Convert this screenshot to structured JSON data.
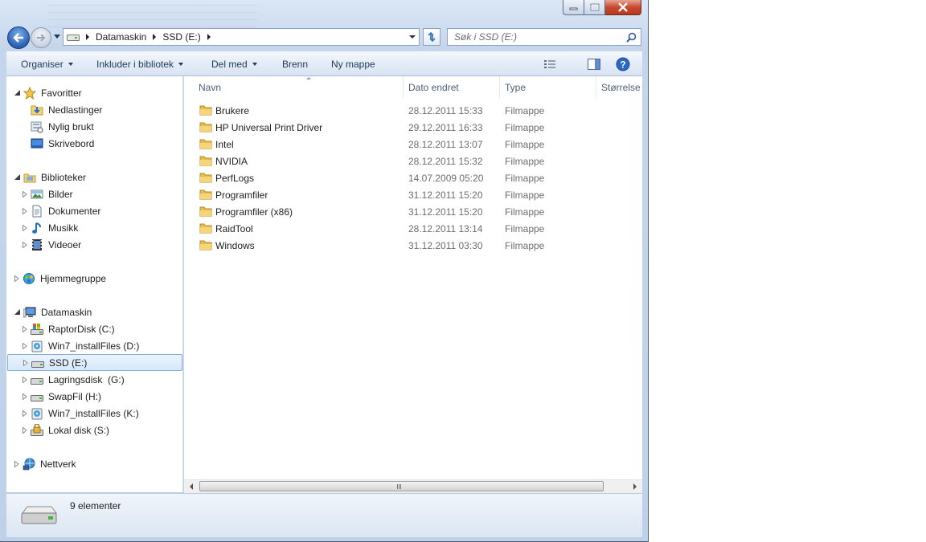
{
  "window": {
    "caption_buttons": [
      "minimize-icon",
      "maximize-icon",
      "close-icon"
    ],
    "close_color": "#c6492e"
  },
  "nav": {
    "back_icon": "back-arrow-icon",
    "forward_icon": "forward-arrow-icon",
    "address": {
      "crumbs": [
        "Datamaskin",
        "SSD (E:)"
      ]
    },
    "search_placeholder": "Søk i SSD (E:)"
  },
  "toolbar": {
    "organise": "Organiser",
    "include_library": "Inkluder i bibliotek",
    "share": "Del med",
    "burn": "Brenn",
    "new_folder": "Ny mappe"
  },
  "sidebar": {
    "favorites": {
      "label": "Favoritter",
      "items": [
        {
          "label": "Nedlastinger",
          "icon": "downloads-icon"
        },
        {
          "label": "Nylig brukt",
          "icon": "recent-places-icon"
        },
        {
          "label": "Skrivebord",
          "icon": "desktop-icon"
        }
      ]
    },
    "libraries": {
      "label": "Biblioteker",
      "items": [
        {
          "label": "Bilder",
          "icon": "pictures-icon"
        },
        {
          "label": "Dokumenter",
          "icon": "documents-icon"
        },
        {
          "label": "Musikk",
          "icon": "music-icon"
        },
        {
          "label": "Videoer",
          "icon": "videos-icon"
        }
      ]
    },
    "homegroup": {
      "label": "Hjemmegruppe"
    },
    "computer": {
      "label": "Datamaskin",
      "items": [
        {
          "label": "RaptorDisk (C:)",
          "icon": "system-drive-icon"
        },
        {
          "label": "Win7_installFiles (D:)",
          "icon": "install-drive-icon"
        },
        {
          "label": "SSD (E:)",
          "icon": "drive-icon",
          "selected": true
        },
        {
          "label": "Lagringsdisk  (G:)",
          "icon": "drive-icon"
        },
        {
          "label": "SwapFil (H:)",
          "icon": "drive-icon"
        },
        {
          "label": "Win7_installFiles (K:)",
          "icon": "install-drive-icon"
        },
        {
          "label": "Lokal disk (S:)",
          "icon": "locked-drive-icon"
        }
      ]
    },
    "network": {
      "label": "Nettverk"
    }
  },
  "columns": {
    "name": "Navn",
    "date": "Dato endret",
    "type": "Type",
    "size": "Størrelse"
  },
  "files": [
    {
      "name": "Brukere",
      "date": "28.12.2011 15:33",
      "type": "Filmappe"
    },
    {
      "name": "HP Universal Print Driver",
      "date": "29.12.2011 16:33",
      "type": "Filmappe"
    },
    {
      "name": "Intel",
      "date": "28.12.2011 13:07",
      "type": "Filmappe"
    },
    {
      "name": "NVIDIA",
      "date": "28.12.2011 15:32",
      "type": "Filmappe"
    },
    {
      "name": "PerfLogs",
      "date": "14.07.2009 05:20",
      "type": "Filmappe"
    },
    {
      "name": "Programfiler",
      "date": "31.12.2011 15:20",
      "type": "Filmappe"
    },
    {
      "name": "Programfiler (x86)",
      "date": "31.12.2011 15:20",
      "type": "Filmappe"
    },
    {
      "name": "RaidTool",
      "date": "28.12.2011 13:14",
      "type": "Filmappe"
    },
    {
      "name": "Windows",
      "date": "31.12.2011 03:30",
      "type": "Filmappe"
    }
  ],
  "details": {
    "count": "9 elementer",
    "icon": "hard-drive-icon"
  }
}
